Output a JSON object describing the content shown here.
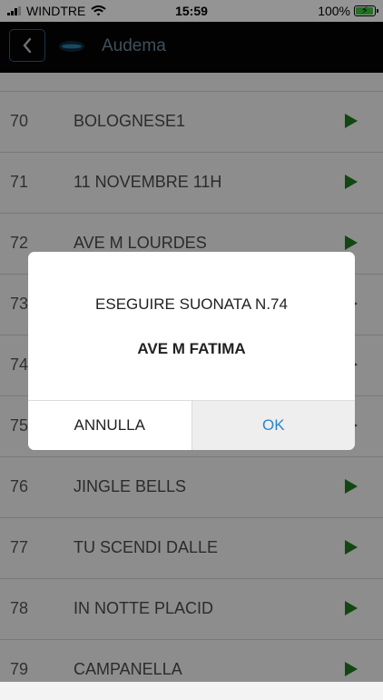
{
  "status_bar": {
    "carrier": "WINDTRE",
    "time": "15:59",
    "battery": "100%",
    "battery_level": 1.0,
    "battery_color": "#3ec13e"
  },
  "header": {
    "title": "Audema",
    "back_icon": "chevron-left-icon",
    "logo_icon": "audema-logo-icon"
  },
  "songs": [
    {
      "num": "70",
      "name": "BOLOGNESE1"
    },
    {
      "num": "71",
      "name": "11 NOVEMBRE 11H"
    },
    {
      "num": "72",
      "name": "AVE M LOURDES"
    },
    {
      "num": "73",
      "name": ""
    },
    {
      "num": "74",
      "name": ""
    },
    {
      "num": "75",
      "name": ""
    },
    {
      "num": "76",
      "name": "JINGLE BELLS"
    },
    {
      "num": "77",
      "name": "TU SCENDI DALLE"
    },
    {
      "num": "78",
      "name": "IN NOTTE PLACID"
    },
    {
      "num": "79",
      "name": "CAMPANELLA"
    }
  ],
  "dialog": {
    "message": "ESEGUIRE SUONATA N.74",
    "song": "AVE M FATIMA",
    "cancel_label": "ANNULLA",
    "ok_label": "OK"
  },
  "colors": {
    "header_bg": "#050505",
    "play_green": "#1f7a1f",
    "accent_blue": "#2a86c8"
  }
}
